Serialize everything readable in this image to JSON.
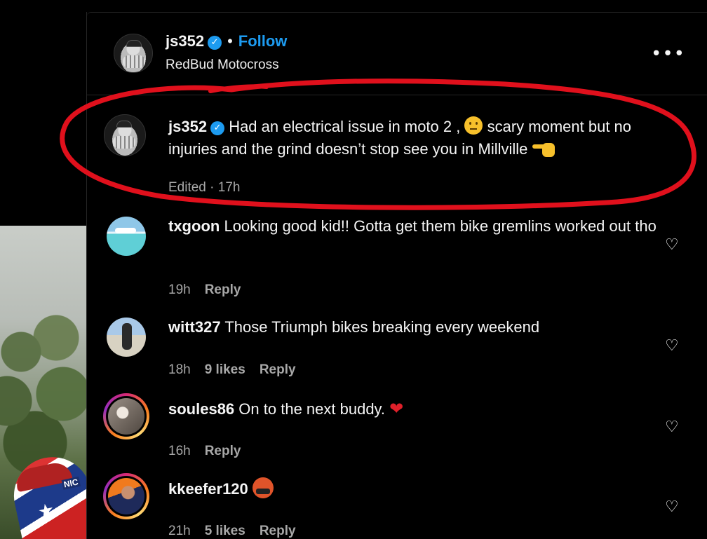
{
  "post": {
    "author": "js352",
    "follow_label": "Follow",
    "separator": "•",
    "location": "RedBud Motocross",
    "more_icon": "•••"
  },
  "caption": {
    "author": "js352",
    "text_part1": "Had an electrical issue in moto 2 ,",
    "text_part2": "scary moment but no injuries and the grind doesn’t stop see you in Millville",
    "meta": "Edited · 17h"
  },
  "comments": [
    {
      "user": "txgoon",
      "text": "Looking good kid!! Gotta get them bike gremlins worked out tho",
      "time": "19h",
      "likes": "",
      "reply": "Reply"
    },
    {
      "user": "witt327",
      "text": "Those Triumph bikes breaking every weekend",
      "time": "18h",
      "likes": "9 likes",
      "reply": "Reply"
    },
    {
      "user": "soules86",
      "text": "On to the next buddy.",
      "time": "16h",
      "likes": "",
      "reply": "Reply"
    },
    {
      "user": "kkeefer120",
      "text": "",
      "time": "21h",
      "likes": "5 likes",
      "reply": "Reply"
    }
  ],
  "icons": {
    "verified": "✓",
    "heart_outline": "♡",
    "red_heart": "❤"
  },
  "colors": {
    "background": "#000000",
    "accent_blue": "#1d9bf0",
    "annotation_red": "#e0101c",
    "muted_text": "#a8a8a8"
  }
}
